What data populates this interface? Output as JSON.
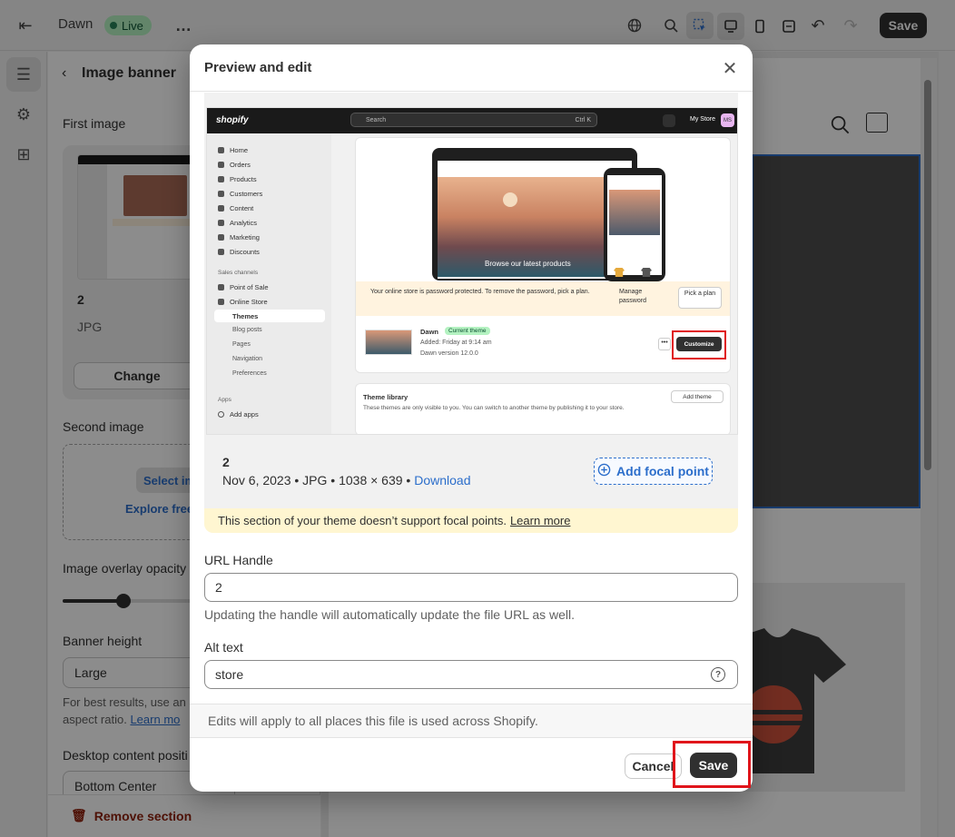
{
  "topbar": {
    "store_name": "Dawn",
    "status_badge": "Live",
    "more_icon": "…",
    "save_label": "Save",
    "icons": [
      "exit-icon",
      "globe-icon",
      "search-icon",
      "inspector-icon",
      "desktop-icon",
      "mobile-icon",
      "fullscreen-icon",
      "undo-icon",
      "redo-icon"
    ]
  },
  "panel": {
    "title": "Image banner",
    "first_image_label": "First image",
    "first_image_name": "2",
    "first_image_type": "JPG",
    "change_label": "Change",
    "second_image_label": "Second image",
    "select_image_label": "Select im",
    "explore_label": "Explore free",
    "opacity_label": "Image overlay opacity",
    "opacity_value": 0.42,
    "height_label": "Banner height",
    "height_value": "Large",
    "height_help_1": "For best results, use an",
    "height_help_2": "aspect ratio.",
    "height_help_link": "Learn mo",
    "position_label": "Desktop content positi",
    "position_value": "Bottom Center",
    "remove_label": "Remove section"
  },
  "modal": {
    "title": "Preview and edit",
    "file_name": "2",
    "file_meta": "Nov 6, 2023 • JPG • 1038 × 639 •",
    "download_label": "Download",
    "focal_label": "Add focal point",
    "warning_text": "This section of your theme doesn’t support focal points.",
    "warning_link": "Learn more",
    "url_label": "URL Handle",
    "url_value": "2",
    "url_help": "Updating the handle will automatically update the file URL as well.",
    "alt_label": "Alt text",
    "alt_value": "store",
    "footnote": "Edits will apply to all places this file is used across Shopify.",
    "cancel_label": "Cancel",
    "save_label": "Save"
  },
  "screenshot": {
    "brand": "shopify",
    "search_placeholder": "Search",
    "search_shortcut": "Ctrl K",
    "store_label": "My Store",
    "store_initials": "MS",
    "nav": [
      "Home",
      "Orders",
      "Products",
      "Customers",
      "Content",
      "Analytics",
      "Marketing",
      "Discounts"
    ],
    "sales_channels_label": "Sales channels",
    "channels": [
      "Point of Sale",
      "Online Store"
    ],
    "online_store_items": [
      "Themes",
      "Blog posts",
      "Pages",
      "Navigation",
      "Preferences"
    ],
    "apps_label": "Apps",
    "add_apps_label": "Add apps",
    "hero_text": "Browse our latest products",
    "password_notice": "Your online store is password protected. To remove the password, pick a plan.",
    "manage_password": "Manage password",
    "pick_plan": "Pick a plan",
    "theme_name": "Dawn",
    "current_theme_badge": "Current theme",
    "theme_added": "Added: Friday at 9:14 am",
    "theme_version": "Dawn version 12.0.0",
    "customize_label": "Customize",
    "library_title": "Theme library",
    "library_desc": "These themes are only visible to you. You can switch to another theme by publishing it to your store.",
    "add_theme_label": "Add theme"
  },
  "colors": {
    "accent": "#2c6ecb",
    "highlight": "#e0151b",
    "live": "#29845a"
  }
}
